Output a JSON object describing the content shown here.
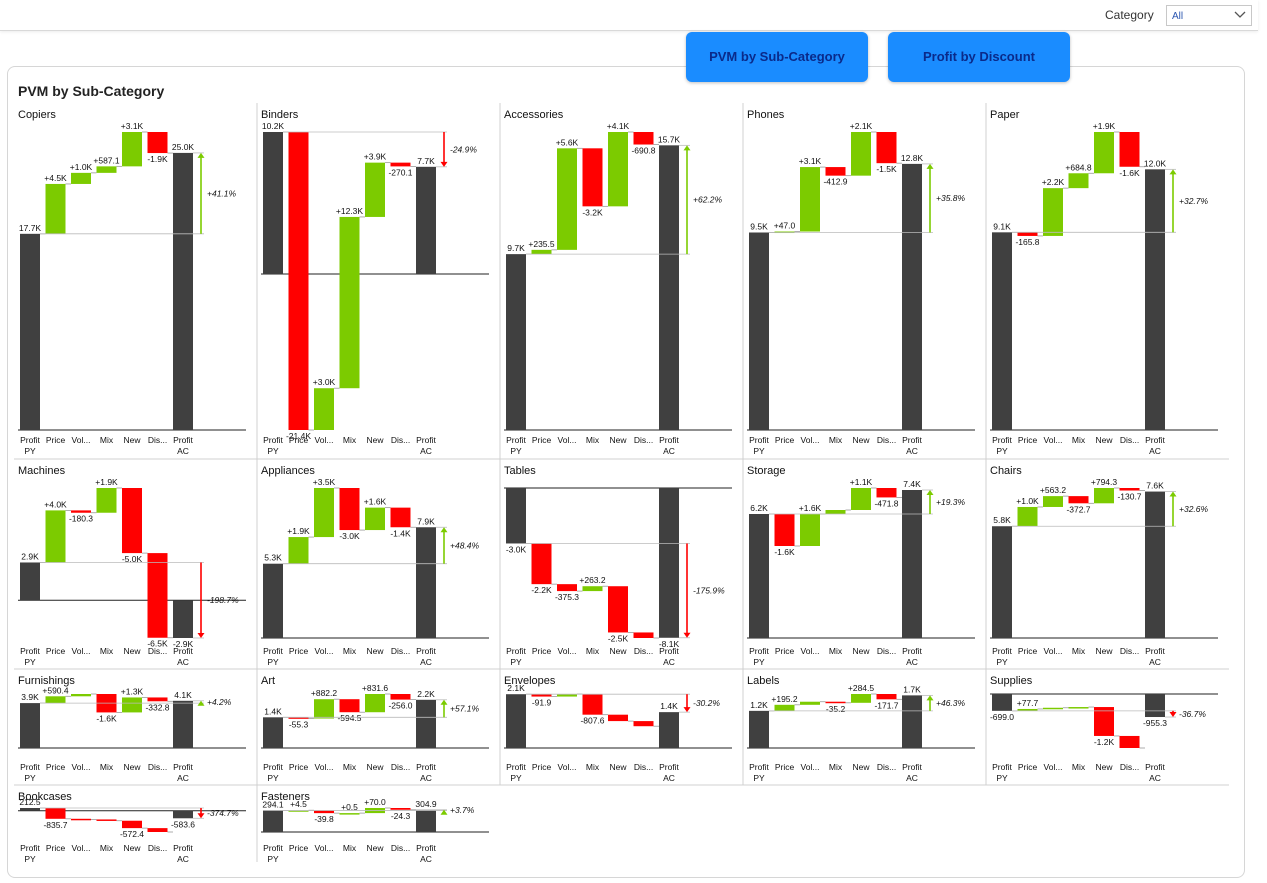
{
  "filter": {
    "label": "Category",
    "value": "All"
  },
  "buttons": {
    "pvm": "PVM by Sub-Category",
    "discount": "Profit by Discount"
  },
  "panel_title": "PVM by Sub-Category",
  "colors": {
    "total": "#404040",
    "increase": "#7ccb00",
    "decrease": "#ff0000",
    "button": "#1a8cff"
  },
  "chart_data": [
    {
      "type": "waterfall",
      "title": "Copiers",
      "categories": [
        "Profit PY",
        "Price",
        "Vol...",
        "Mix",
        "New",
        "Dis...",
        "Profit AC"
      ],
      "values": [
        17.7,
        4.5,
        1.0,
        0.5871,
        3.1,
        -1.9,
        25.0
      ],
      "labels": [
        "17.7K",
        "+4.5K",
        "+1.0K",
        "+587.1",
        "+3.1K",
        "-1.9K",
        "25.0K"
      ],
      "delta": "+41.1%"
    },
    {
      "type": "waterfall",
      "title": "Binders",
      "categories": [
        "Profit PY",
        "Price",
        "Vol...",
        "Mix",
        "New",
        "Dis...",
        "Profit AC"
      ],
      "values": [
        10.2,
        -21.4,
        3.0,
        12.3,
        3.9,
        -0.2701,
        7.7
      ],
      "labels": [
        "10.2K",
        "-21.4K",
        "+3.0K",
        "+12.3K",
        "+3.9K",
        "-270.1",
        "7.7K"
      ],
      "delta": "-24.9%"
    },
    {
      "type": "waterfall",
      "title": "Accessories",
      "categories": [
        "Profit PY",
        "Price",
        "Vol...",
        "Mix",
        "New",
        "Dis...",
        "Profit AC"
      ],
      "values": [
        9.7,
        0.2355,
        5.6,
        -3.2,
        4.1,
        -0.6908,
        15.7
      ],
      "labels": [
        "9.7K",
        "+235.5",
        "+5.6K",
        "-3.2K",
        "+4.1K",
        "-690.8",
        "15.7K"
      ],
      "delta": "+62.2%"
    },
    {
      "type": "waterfall",
      "title": "Phones",
      "categories": [
        "Profit PY",
        "Price",
        "Vol...",
        "Mix",
        "New",
        "Dis...",
        "Profit AC"
      ],
      "values": [
        9.5,
        0.047,
        3.1,
        -0.4129,
        2.1,
        -1.5,
        12.8
      ],
      "labels": [
        "9.5K",
        "+47.0",
        "+3.1K",
        "-412.9",
        "+2.1K",
        "-1.5K",
        "12.8K"
      ],
      "delta": "+35.8%"
    },
    {
      "type": "waterfall",
      "title": "Paper",
      "categories": [
        "Profit PY",
        "Price",
        "Vol...",
        "Mix",
        "New",
        "Dis...",
        "Profit AC"
      ],
      "values": [
        9.1,
        -0.1658,
        2.2,
        0.6848,
        1.9,
        -1.6,
        12.0
      ],
      "labels": [
        "9.1K",
        "-165.8",
        "+2.2K",
        "+684.8",
        "+1.9K",
        "-1.6K",
        "12.0K"
      ],
      "delta": "+32.7%"
    },
    {
      "type": "waterfall",
      "title": "Machines",
      "categories": [
        "Profit PY",
        "Price",
        "Vol...",
        "Mix",
        "New",
        "Dis...",
        "Profit AC"
      ],
      "values": [
        2.9,
        4.0,
        -0.1803,
        1.9,
        -5.0,
        -6.5,
        -2.9
      ],
      "labels": [
        "2.9K",
        "+4.0K",
        "-180.3",
        "+1.9K",
        "-5.0K",
        "-6.5K",
        "-2.9K"
      ],
      "delta": "-198.7%"
    },
    {
      "type": "waterfall",
      "title": "Appliances",
      "categories": [
        "Profit PY",
        "Price",
        "Vol...",
        "Mix",
        "New",
        "Dis...",
        "Profit AC"
      ],
      "values": [
        5.3,
        1.9,
        3.5,
        -3.0,
        1.6,
        -1.4,
        7.9
      ],
      "labels": [
        "5.3K",
        "+1.9K",
        "+3.5K",
        "-3.0K",
        "+1.6K",
        "-1.4K",
        "7.9K"
      ],
      "delta": "+48.4%"
    },
    {
      "type": "waterfall",
      "title": "Tables",
      "categories": [
        "Profit PY",
        "Price",
        "Vol...",
        "Mix",
        "New",
        "Dis...",
        "Profit AC"
      ],
      "values": [
        -3.0,
        -2.2,
        -0.3753,
        0.2632,
        -2.5,
        -0.3,
        -8.1
      ],
      "labels": [
        "-3.0K",
        "-2.2K",
        "-375.3",
        "+263.2",
        "-2.5K",
        "",
        "-8.1K"
      ],
      "delta": "-175.9%"
    },
    {
      "type": "waterfall",
      "title": "Storage",
      "categories": [
        "Profit PY",
        "Price",
        "Vol...",
        "Mix",
        "New",
        "Dis...",
        "Profit AC"
      ],
      "values": [
        6.2,
        -1.6,
        1.6,
        0.2,
        1.1,
        -0.4718,
        7.4
      ],
      "labels": [
        "6.2K",
        "-1.6K",
        "+1.6K",
        "",
        "+1.1K",
        "-471.8",
        "7.4K"
      ],
      "delta": "+19.3%"
    },
    {
      "type": "waterfall",
      "title": "Chairs",
      "categories": [
        "Profit PY",
        "Price",
        "Vol...",
        "Mix",
        "New",
        "Dis...",
        "Profit AC"
      ],
      "values": [
        5.8,
        1.0,
        0.5632,
        -0.3727,
        0.7943,
        -0.1307,
        7.6
      ],
      "labels": [
        "5.8K",
        "+1.0K",
        "+563.2",
        "-372.7",
        "+794.3",
        "-130.7",
        "7.6K"
      ],
      "delta": "+32.6%"
    },
    {
      "type": "waterfall",
      "title": "Furnishings",
      "categories": [
        "Profit PY",
        "Price",
        "Vol...",
        "Mix",
        "New",
        "Dis...",
        "Profit AC"
      ],
      "values": [
        3.9,
        0.5904,
        0.2,
        -1.6,
        1.3,
        -0.3328,
        4.1
      ],
      "labels": [
        "3.9K",
        "+590.4",
        "",
        "-1.6K",
        "+1.3K",
        "-332.8",
        "4.1K"
      ],
      "delta": "+4.2%"
    },
    {
      "type": "waterfall",
      "title": "Art",
      "categories": [
        "Profit PY",
        "Price",
        "Vol...",
        "Mix",
        "New",
        "Dis...",
        "Profit AC"
      ],
      "values": [
        1.4,
        -0.0553,
        0.8822,
        -0.5945,
        0.8316,
        -0.256,
        2.2
      ],
      "labels": [
        "1.4K",
        "-55.3",
        "+882.2",
        "-594.5",
        "+831.6",
        "-256.0",
        "2.2K"
      ],
      "delta": "+57.1%"
    },
    {
      "type": "waterfall",
      "title": "Envelopes",
      "categories": [
        "Profit PY",
        "Price",
        "Vol...",
        "Mix",
        "New",
        "Dis...",
        "Profit AC"
      ],
      "values": [
        2.1,
        -0.0919,
        0.1,
        -0.8076,
        -0.25,
        -0.2,
        1.4
      ],
      "labels": [
        "2.1K",
        "-91.9",
        "",
        "-807.6",
        "",
        "",
        "1.4K"
      ],
      "delta": "-30.2%"
    },
    {
      "type": "waterfall",
      "title": "Labels",
      "categories": [
        "Profit PY",
        "Price",
        "Vol...",
        "Mix",
        "New",
        "Dis...",
        "Profit AC"
      ],
      "values": [
        1.2,
        0.1952,
        0.1,
        -0.0352,
        0.2845,
        -0.1717,
        1.7
      ],
      "labels": [
        "1.2K",
        "+195.2",
        "",
        "-35.2",
        "+284.5",
        "-171.7",
        "1.7K"
      ],
      "delta": "+46.3%"
    },
    {
      "type": "waterfall",
      "title": "Supplies",
      "categories": [
        "Profit PY",
        "Price",
        "Vol...",
        "Mix",
        "New",
        "Dis...",
        "Profit AC"
      ],
      "values": [
        -0.699,
        0.0777,
        0.05,
        0.03,
        -1.2,
        -0.5,
        -0.9553
      ],
      "labels": [
        "-699.0",
        "+77.7",
        "",
        "",
        "-1.2K",
        "",
        "-955.3"
      ],
      "delta": "-36.7%"
    },
    {
      "type": "waterfall",
      "title": "Bookcases",
      "categories": [
        "Profit PY",
        "Price",
        "Vol...",
        "Mix",
        "New",
        "Dis...",
        "Profit AC"
      ],
      "values": [
        0.2125,
        -0.8357,
        -0.05,
        -0.1,
        -0.5724,
        -0.3,
        -0.5836
      ],
      "labels": [
        "212.5",
        "-835.7",
        "",
        "",
        "-572.4",
        "",
        "-583.6"
      ],
      "delta": "-374.7%"
    },
    {
      "type": "waterfall",
      "title": "Fasteners",
      "categories": [
        "Profit PY",
        "Price",
        "Vol...",
        "Mix",
        "New",
        "Dis...",
        "Profit AC"
      ],
      "values": [
        0.2941,
        0.0045,
        -0.0398,
        0.0005,
        0.07,
        -0.0243,
        0.3049
      ],
      "labels": [
        "294.1",
        "+4.5",
        "-39.8",
        "+0.5",
        "+70.0",
        "-24.3",
        "304.9"
      ],
      "delta": "+3.7%"
    }
  ]
}
